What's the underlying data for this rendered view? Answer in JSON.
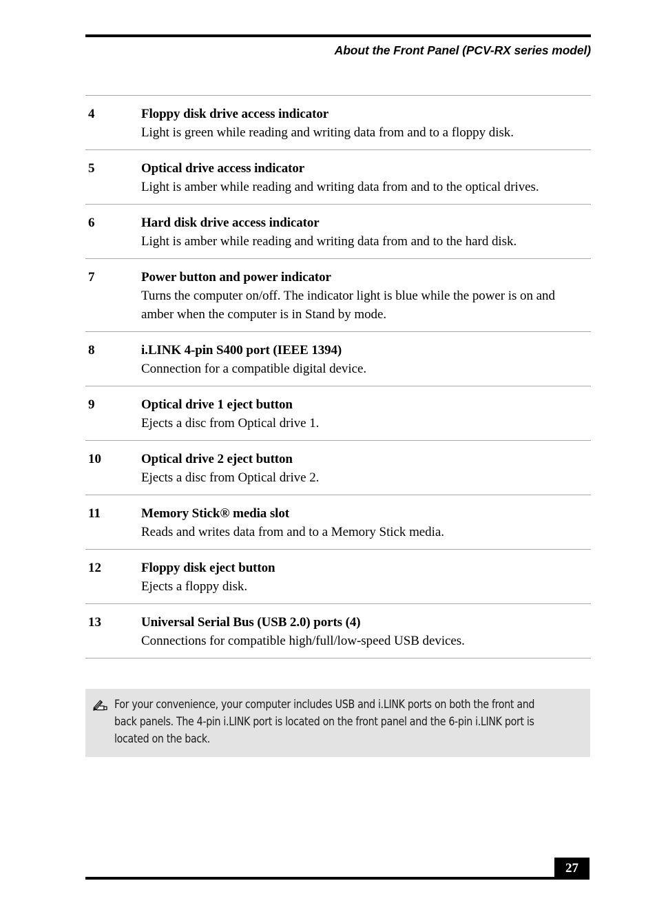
{
  "header": {
    "title": "About the Front Panel (PCV-RX series model)"
  },
  "table": {
    "rows": [
      {
        "num": "4",
        "title": "Floppy disk drive access indicator",
        "desc": "Light is green while reading and writing data from and to a floppy disk."
      },
      {
        "num": "5",
        "title": "Optical drive access indicator",
        "desc": "Light is amber while reading and writing data from and to the optical drives."
      },
      {
        "num": "6",
        "title": "Hard disk drive access indicator",
        "desc": "Light is amber while reading and writing data from and to the hard disk."
      },
      {
        "num": "7",
        "title": "Power button and power indicator",
        "desc": "Turns the computer on/off. The indicator light is blue while the power is on and amber when the computer is in Stand by mode."
      },
      {
        "num": "8",
        "title": "i.LINK 4-pin S400 port (IEEE 1394)",
        "desc": "Connection for a compatible digital device."
      },
      {
        "num": "9",
        "title": "Optical drive 1 eject button",
        "desc": "Ejects a disc from Optical drive 1."
      },
      {
        "num": "10",
        "title": "Optical drive 2 eject button",
        "desc": "Ejects a disc from Optical drive 2."
      },
      {
        "num": "11",
        "title": "Memory Stick® media slot",
        "desc": "Reads and writes data from and to a Memory Stick media."
      },
      {
        "num": "12",
        "title": "Floppy disk eject button",
        "desc": "Ejects a floppy disk."
      },
      {
        "num": "13",
        "title": "Universal Serial Bus (USB 2.0) ports (4)",
        "desc": "Connections for compatible high/full/low-speed USB devices."
      }
    ]
  },
  "note": {
    "icon": "note-pencil-hand-icon",
    "background_color": "#e3e3e3",
    "text": "For your convenience, your computer includes USB and i.LINK ports on both the front and back panels. The 4-pin i.LINK port is located on the front panel and the 6-pin i.LINK port is located on the back."
  },
  "footer": {
    "page_number": "27",
    "page_box_color": "#000000",
    "page_number_color": "#ffffff"
  }
}
